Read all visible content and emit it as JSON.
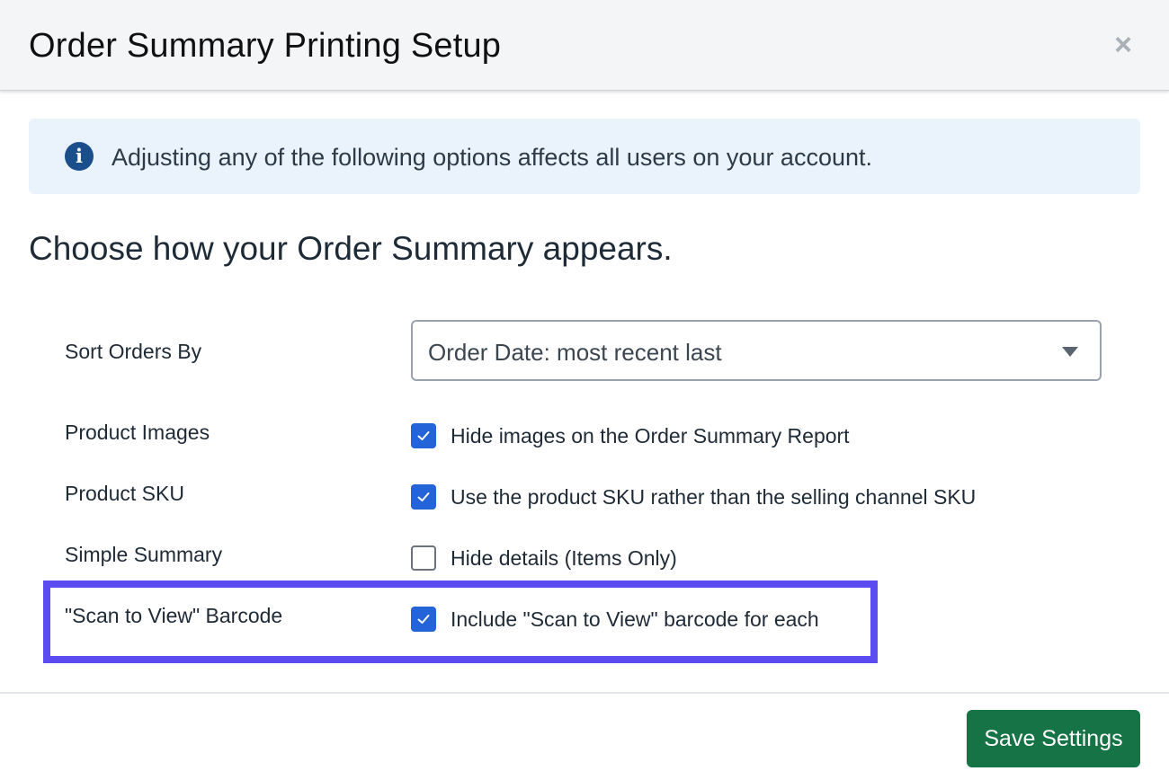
{
  "dialog": {
    "title": "Order Summary Printing Setup",
    "close_symbol": "×"
  },
  "info_banner": {
    "icon": "info-circle-icon",
    "icon_glyph": "i",
    "text": "Adjusting any of the following options affects all users on your account."
  },
  "section": {
    "heading": "Choose how your Order Summary appears."
  },
  "settings": {
    "sort_orders": {
      "label": "Sort Orders By",
      "selected": "Order Date: most recent last"
    },
    "product_images": {
      "label": "Product Images",
      "checkbox_label": "Hide images on the Order Summary Report",
      "checked": true
    },
    "product_sku": {
      "label": "Product SKU",
      "checkbox_label": "Use the product SKU rather than the selling channel SKU",
      "checked": true
    },
    "simple_summary": {
      "label": "Simple Summary",
      "checkbox_label": "Hide details (Items Only)",
      "checked": false
    },
    "scan_to_view": {
      "label": "\"Scan to View\" Barcode",
      "checkbox_label": "Include \"Scan to View\" barcode for each",
      "checked": true
    }
  },
  "footer": {
    "save_label": "Save Settings"
  },
  "colors": {
    "accent_blue": "#2563d9",
    "save_green": "#167346",
    "highlight_purple": "#5b4cf0",
    "info_bg": "#eaf2fb",
    "info_icon": "#1a4f8c"
  }
}
